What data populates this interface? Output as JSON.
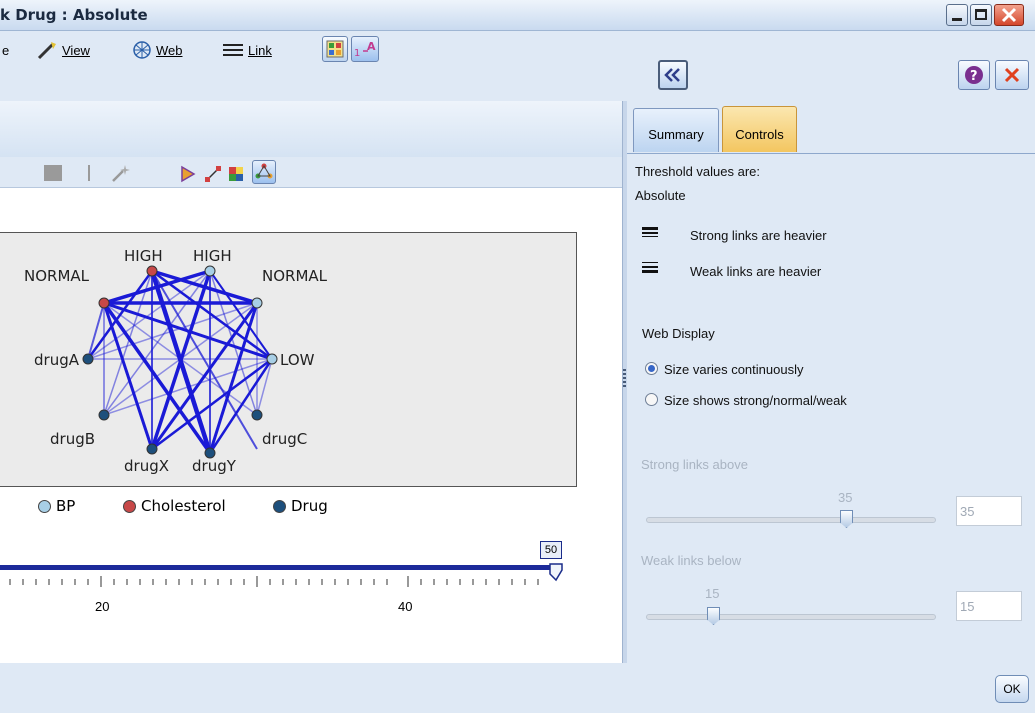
{
  "window": {
    "title": "k Drug : Absolute"
  },
  "toolbar": {
    "partial_item": "e",
    "view_label": "View",
    "web_label": "Web",
    "link_label": "Link",
    "collapse_icon": "double-chevron-left-icon",
    "help_icon": "question-icon",
    "close_icon": "close-icon"
  },
  "web": {
    "nodes": {
      "normal_left": "NORMAL",
      "high_left": "HIGH",
      "high_right": "HIGH",
      "normal_right": "NORMAL",
      "druga": "drugA",
      "low": "LOW",
      "drugb": "drugB",
      "drugc": "drugC",
      "drugx": "drugX",
      "drugy": "drugY"
    },
    "legend": {
      "bp": "BP",
      "cholesterol": "Cholesterol",
      "drug": "Drug"
    },
    "colors": {
      "bp": "#a8cfe6",
      "cholesterol": "#c74848",
      "drug": "#1d4f7c",
      "link": "#1a1ad6"
    }
  },
  "slider": {
    "value_label": "50",
    "tick_20": "20",
    "tick_40": "40"
  },
  "right_panel": {
    "tabs": {
      "summary": "Summary",
      "controls": "Controls"
    },
    "threshold_label": "Threshold values are:",
    "threshold_value": "Absolute",
    "strong_heavier": "Strong links are heavier",
    "weak_heavier": "Weak links are heavier",
    "web_display": "Web Display",
    "size_continuous": "Size varies continuously",
    "size_snw": "Size shows strong/normal/weak",
    "strong_above_label": "Strong links above",
    "strong_value": "35",
    "strong_box": "35",
    "weak_below_label": "Weak links below",
    "weak_value": "15",
    "weak_box": "15",
    "ok": "OK"
  }
}
